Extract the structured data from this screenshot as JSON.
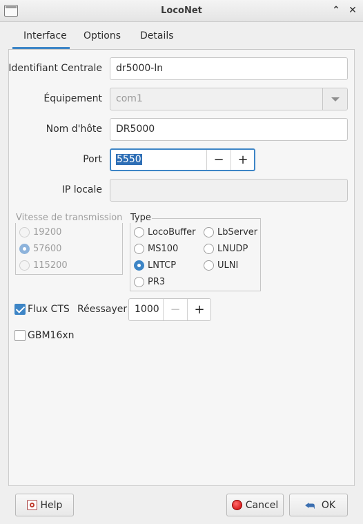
{
  "window": {
    "title": "LocoNet",
    "icon": "window-icon",
    "controls": [
      "chevron-up-icon",
      "close-icon"
    ]
  },
  "tabs": [
    {
      "label": "Interface",
      "active": true
    },
    {
      "label": "Options",
      "active": false
    },
    {
      "label": "Details",
      "active": false
    }
  ],
  "form": {
    "identifiant": {
      "label": "Identifiant Centrale",
      "value": "dr5000-ln"
    },
    "equipement": {
      "label": "Équipement",
      "value": "com1"
    },
    "hostname": {
      "label": "Nom d'hôte",
      "value": "DR5000"
    },
    "port": {
      "label": "Port",
      "value": "5550",
      "minus": "−",
      "plus": "+"
    },
    "ip_locale": {
      "label": "IP locale",
      "value": ""
    }
  },
  "baud_group": {
    "title": "Vitesse de transmission",
    "options": [
      {
        "label": "19200",
        "selected": false
      },
      {
        "label": "57600",
        "selected": true
      },
      {
        "label": "115200",
        "selected": false
      }
    ]
  },
  "type_group": {
    "title": "Type",
    "options": [
      {
        "label": "LocoBuffer",
        "selected": false
      },
      {
        "label": "LbServer",
        "selected": false
      },
      {
        "label": "MS100",
        "selected": false
      },
      {
        "label": "LNUDP",
        "selected": false
      },
      {
        "label": "LNTCP",
        "selected": true
      },
      {
        "label": "ULNI",
        "selected": false
      },
      {
        "label": "PR3",
        "selected": false
      }
    ]
  },
  "flux_cts": {
    "label": "Flux CTS",
    "checked": true
  },
  "reessayer": {
    "label": "Réessayer",
    "value": "1000",
    "minus": "−",
    "plus": "+"
  },
  "gbm16xn": {
    "label": "GBM16xn",
    "checked": false
  },
  "buttons": {
    "help": "Help",
    "cancel": "Cancel",
    "ok": "OK"
  },
  "colors": {
    "accent": "#3d85c6",
    "background": "#efefef"
  }
}
